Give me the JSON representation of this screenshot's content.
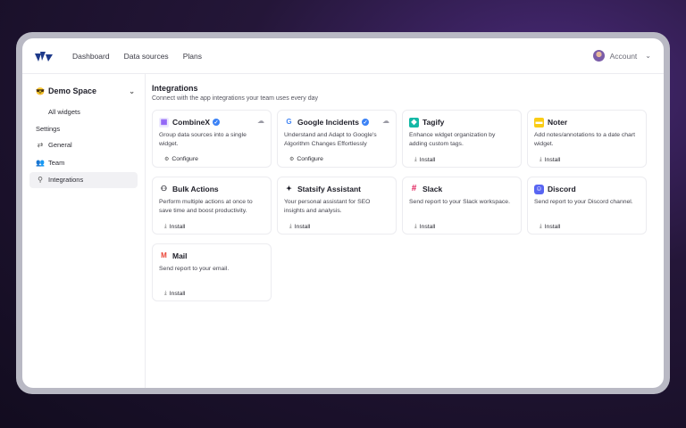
{
  "nav": {
    "links": [
      "Dashboard",
      "Data sources",
      "Plans"
    ],
    "account_label": "Account"
  },
  "sidebar": {
    "space_emoji": "😎",
    "space_name": "Demo Space",
    "all_widgets": "All widgets",
    "settings_heading": "Settings",
    "items": [
      {
        "label": "General",
        "icon": "sliders-icon"
      },
      {
        "label": "Team",
        "icon": "users-icon"
      },
      {
        "label": "Integrations",
        "icon": "search-icon"
      }
    ]
  },
  "main": {
    "title": "Integrations",
    "subtitle": "Connect with the app integrations your team uses every day"
  },
  "integrations": [
    {
      "name": "CombineX",
      "desc": "Group data sources into a single widget.",
      "action": "Configure",
      "verified": true,
      "cloud": true,
      "icon": "combinex-icon",
      "color": "#a78bfa"
    },
    {
      "name": "Google Incidents",
      "desc": "Understand and Adapt to Google's Algorithm Changes Effortlessly",
      "action": "Configure",
      "verified": true,
      "cloud": true,
      "icon": "google-icon",
      "color": "#4285f4"
    },
    {
      "name": "Tagify",
      "desc": "Enhance widget organization by adding custom tags.",
      "action": "Install",
      "verified": false,
      "cloud": false,
      "icon": "tag-icon",
      "color": "#14b8a6"
    },
    {
      "name": "Noter",
      "desc": "Add notes/annotations to a date chart widget.",
      "action": "Install",
      "verified": false,
      "cloud": false,
      "icon": "note-icon",
      "color": "#facc15"
    },
    {
      "name": "Bulk Actions",
      "desc": "Perform multiple actions at once to save time and boost productivity.",
      "action": "Install",
      "verified": false,
      "cloud": false,
      "icon": "bulk-actions-icon",
      "color": "#1e1e28"
    },
    {
      "name": "Statsify Assistant",
      "desc": "Your personal assistant for SEO insights and analysis.",
      "action": "Install",
      "verified": false,
      "cloud": false,
      "icon": "sparkle-icon",
      "color": "#1e1e28"
    },
    {
      "name": "Slack",
      "desc": "Send report to your Slack workspace.",
      "action": "Install",
      "verified": false,
      "cloud": false,
      "icon": "slack-icon",
      "color": "#e01e5a"
    },
    {
      "name": "Discord",
      "desc": "Send report to your Discord channel.",
      "action": "Install",
      "verified": false,
      "cloud": false,
      "icon": "discord-icon",
      "color": "#5865f2"
    },
    {
      "name": "Mail",
      "desc": "Send report to your email.",
      "action": "Install",
      "verified": false,
      "cloud": false,
      "icon": "gmail-icon",
      "color": "#ea4335"
    }
  ]
}
